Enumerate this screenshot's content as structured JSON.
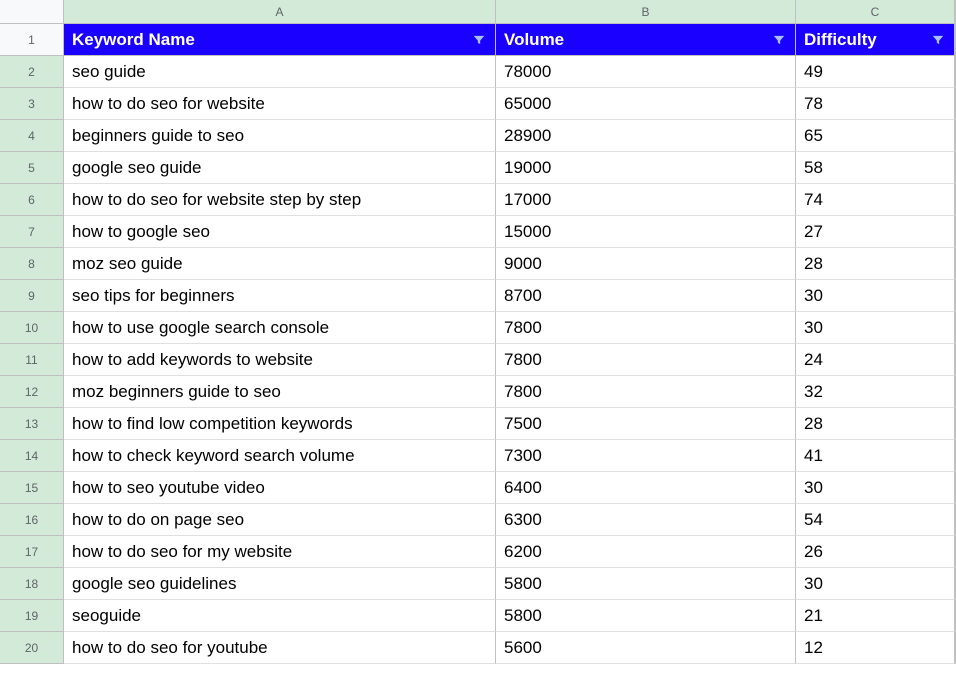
{
  "columns": [
    "A",
    "B",
    "C"
  ],
  "headers": {
    "col_a": "Keyword Name",
    "col_b": "Volume",
    "col_c": "Difficulty"
  },
  "rows": [
    {
      "n": "1"
    },
    {
      "n": "2",
      "a": "seo guide",
      "b": "78000",
      "c": "49"
    },
    {
      "n": "3",
      "a": "how to do seo for website",
      "b": "65000",
      "c": "78"
    },
    {
      "n": "4",
      "a": "beginners guide to seo",
      "b": "28900",
      "c": "65"
    },
    {
      "n": "5",
      "a": "google seo guide",
      "b": "19000",
      "c": "58"
    },
    {
      "n": "6",
      "a": "how to do seo for website step by step",
      "b": "17000",
      "c": "74"
    },
    {
      "n": "7",
      "a": "how to google seo",
      "b": "15000",
      "c": "27"
    },
    {
      "n": "8",
      "a": "moz seo guide",
      "b": "9000",
      "c": "28"
    },
    {
      "n": "9",
      "a": "seo tips for beginners",
      "b": "8700",
      "c": "30"
    },
    {
      "n": "10",
      "a": "how to use google search console",
      "b": "7800",
      "c": "30"
    },
    {
      "n": "11",
      "a": "how to add keywords to website",
      "b": "7800",
      "c": "24"
    },
    {
      "n": "12",
      "a": "moz beginners guide to seo",
      "b": "7800",
      "c": "32"
    },
    {
      "n": "13",
      "a": "how to find low competition keywords",
      "b": "7500",
      "c": "28"
    },
    {
      "n": "14",
      "a": "how to check keyword search volume",
      "b": "7300",
      "c": "41"
    },
    {
      "n": "15",
      "a": "how to seo youtube video",
      "b": "6400",
      "c": "30"
    },
    {
      "n": "16",
      "a": "how to do on page seo",
      "b": "6300",
      "c": "54"
    },
    {
      "n": "17",
      "a": "how to do seo for my website",
      "b": "6200",
      "c": "26"
    },
    {
      "n": "18",
      "a": "google seo guidelines",
      "b": "5800",
      "c": "30"
    },
    {
      "n": "19",
      "a": "seoguide",
      "b": "5800",
      "c": "21"
    },
    {
      "n": "20",
      "a": "how to do seo for youtube",
      "b": "5600",
      "c": "12"
    }
  ],
  "chart_data": {
    "type": "table",
    "title": "Keyword data",
    "columns": [
      "Keyword Name",
      "Volume",
      "Difficulty"
    ],
    "data": [
      [
        "seo guide",
        78000,
        49
      ],
      [
        "how to do seo for website",
        65000,
        78
      ],
      [
        "beginners guide to seo",
        28900,
        65
      ],
      [
        "google seo guide",
        19000,
        58
      ],
      [
        "how to do seo for website step by step",
        17000,
        74
      ],
      [
        "how to google seo",
        15000,
        27
      ],
      [
        "moz seo guide",
        9000,
        28
      ],
      [
        "seo tips for beginners",
        8700,
        30
      ],
      [
        "how to use google search console",
        7800,
        30
      ],
      [
        "how to add keywords to website",
        7800,
        24
      ],
      [
        "moz beginners guide to seo",
        7800,
        32
      ],
      [
        "how to find low competition keywords",
        7500,
        28
      ],
      [
        "how to check keyword search volume",
        7300,
        41
      ],
      [
        "how to seo youtube video",
        6400,
        30
      ],
      [
        "how to do on page seo",
        6300,
        54
      ],
      [
        "how to do seo for my website",
        6200,
        26
      ],
      [
        "google seo guidelines",
        5800,
        30
      ],
      [
        "seoguide",
        5800,
        21
      ],
      [
        "how to do seo for youtube",
        5600,
        12
      ]
    ]
  }
}
